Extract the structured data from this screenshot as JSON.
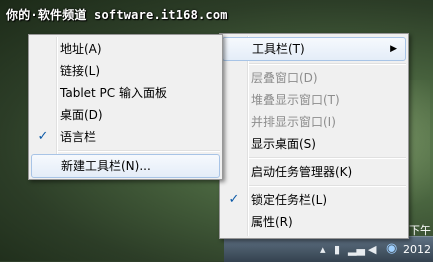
{
  "watermark": "你的·软件频道 software.it168.com",
  "main_menu": {
    "toolbars": "工具栏(T)",
    "cascade": "层叠窗口(D)",
    "stacked": "堆叠显示窗口(T)",
    "side_by_side": "并排显示窗口(I)",
    "show_desktop": "显示桌面(S)",
    "task_manager": "启动任务管理器(K)",
    "lock_taskbar": "锁定任务栏(L)",
    "properties": "属性(R)"
  },
  "toolbars_menu": {
    "address": "地址(A)",
    "links": "链接(L)",
    "tablet_pc": "Tablet PC 输入面板",
    "desktop": "桌面(D)",
    "language_bar": "语言栏",
    "new_toolbar": "新建工具栏(N)..."
  },
  "clock": {
    "line1": "下午",
    "line2": "2012"
  },
  "colors": {
    "menu_bg": "#f0f0f0",
    "highlight_border": "#a8c4e6",
    "check": "#0d5aa7",
    "disabled_text": "#8d8d8d"
  }
}
